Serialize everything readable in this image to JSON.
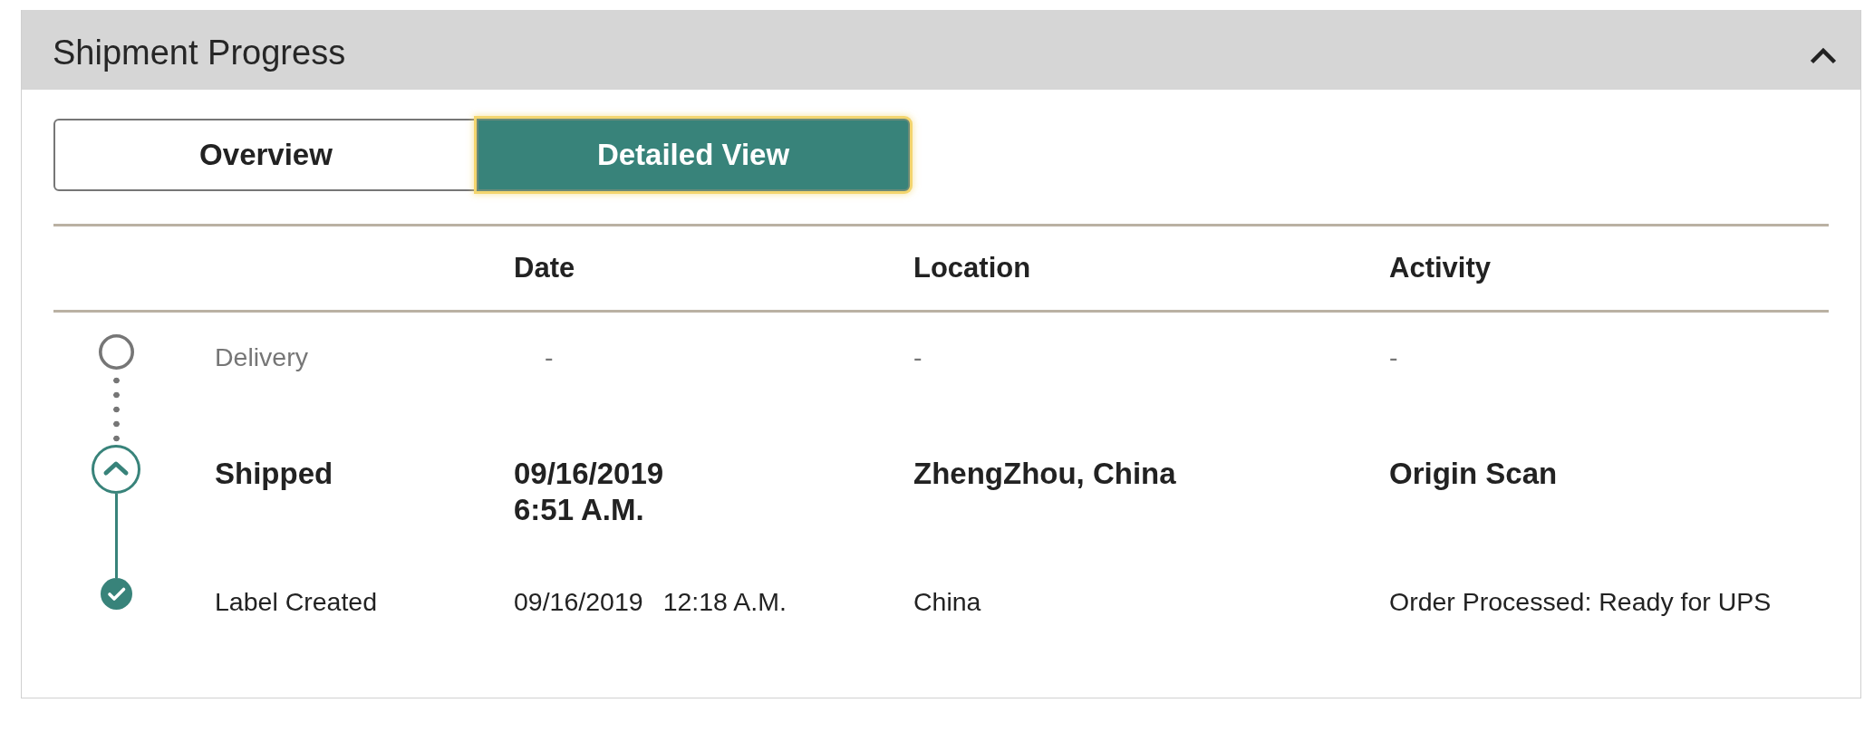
{
  "panel": {
    "title": "Shipment Progress",
    "expanded": true
  },
  "view_tabs": [
    {
      "label": "Overview",
      "selected": false
    },
    {
      "label": "Detailed View",
      "selected": true
    }
  ],
  "table": {
    "columns": [
      "Date",
      "Location",
      "Activity"
    ],
    "rows": [
      {
        "kind": "pending",
        "status": "Delivery",
        "date": "-",
        "location": "-",
        "activity": "-"
      },
      {
        "kind": "current",
        "status": "Shipped",
        "date": "09/16/2019",
        "time": "6:51 A.M.",
        "location": "ZhengZhou, China",
        "activity": "Origin Scan"
      },
      {
        "kind": "done",
        "status": "Label Created",
        "date": "09/16/2019",
        "time": "12:18 A.M.",
        "location": "China",
        "activity": "Order Processed: Ready for UPS"
      }
    ]
  }
}
